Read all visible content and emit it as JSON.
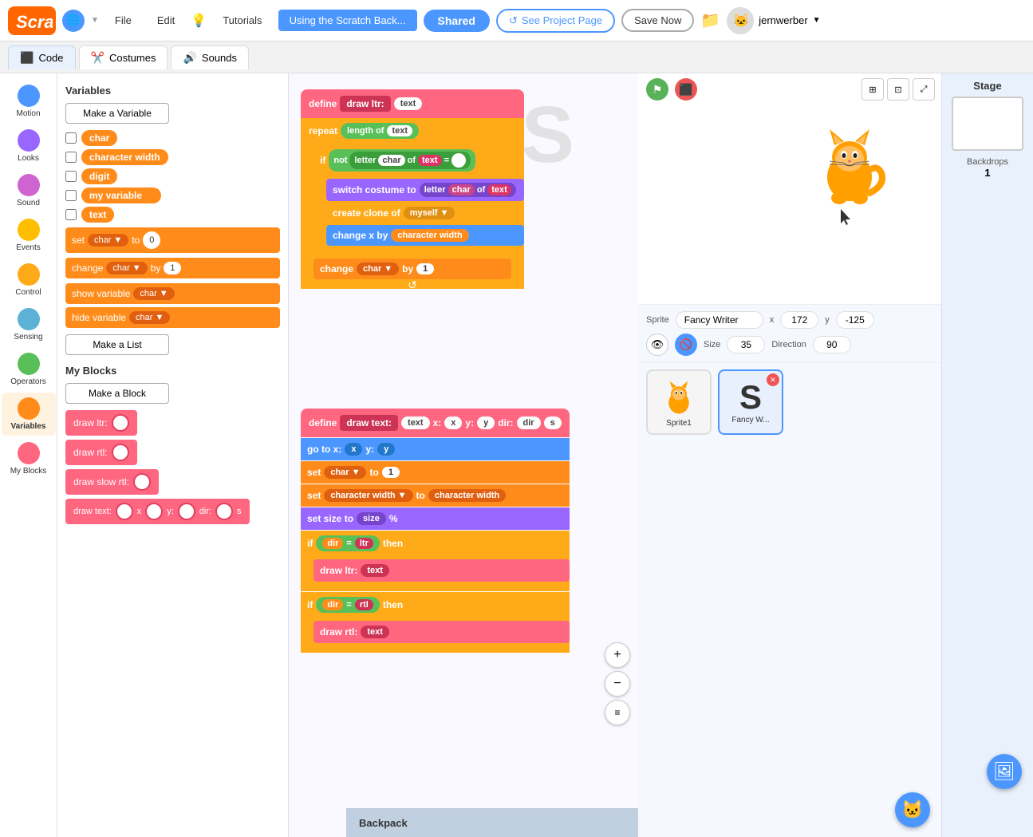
{
  "topbar": {
    "logo": "Scratch",
    "globe_label": "🌐",
    "file_label": "File",
    "edit_label": "Edit",
    "tutorials_label": "Tutorials",
    "project_name": "Using the Scratch Back...",
    "shared_label": "Shared",
    "see_project_label": "See Project Page",
    "save_label": "Save Now",
    "user_label": "jernwerber"
  },
  "tabs": {
    "code_label": "Code",
    "costumes_label": "Costumes",
    "sounds_label": "Sounds"
  },
  "categories": [
    {
      "id": "motion",
      "label": "Motion",
      "color": "#4c97ff"
    },
    {
      "id": "looks",
      "label": "Looks",
      "color": "#9966ff"
    },
    {
      "id": "sound",
      "label": "Sound",
      "color": "#cf63cf"
    },
    {
      "id": "events",
      "label": "Events",
      "color": "#ffbf00"
    },
    {
      "id": "control",
      "label": "Control",
      "color": "#ffab19"
    },
    {
      "id": "sensing",
      "label": "Sensing",
      "color": "#5cb1d6"
    },
    {
      "id": "operators",
      "label": "Operators",
      "color": "#59c059"
    },
    {
      "id": "variables",
      "label": "Variables",
      "color": "#ff8c1a"
    },
    {
      "id": "my-blocks",
      "label": "My Blocks",
      "color": "#ff6680"
    }
  ],
  "variables_section": {
    "title": "Variables",
    "make_variable_btn": "Make a Variable",
    "make_list_btn": "Make a List",
    "vars": [
      {
        "name": "char"
      },
      {
        "name": "character width"
      },
      {
        "name": "digit"
      },
      {
        "name": "my variable"
      },
      {
        "name": "text"
      }
    ],
    "set_block": "set",
    "char_label": "char",
    "to_label": "to",
    "val_0": "0",
    "change_label": "change",
    "by_label": "by",
    "val_1": "1",
    "show_variable": "show variable",
    "hide_variable": "hide variable"
  },
  "my_blocks_section": {
    "title": "My Blocks",
    "make_block_btn": "Make a Block",
    "blocks": [
      {
        "name": "draw ltr:",
        "has_input": true
      },
      {
        "name": "draw rtl:",
        "has_input": true
      },
      {
        "name": "draw slow rtl:",
        "has_input": true
      },
      {
        "name": "draw text:",
        "has_inputs": true
      }
    ]
  },
  "scripts": {
    "stack1": {
      "define_label": "define",
      "fn_name": "draw ltr:",
      "text_arg": "text",
      "repeat_label": "repeat",
      "length_of_label": "length of",
      "if_label": "if",
      "not_label": "not",
      "letter_label": "letter",
      "char_arg": "char",
      "of_label": "of",
      "text_arg2": "text",
      "switch_costume_label": "switch costume to",
      "char_arg2": "char",
      "of_label2": "of",
      "text_arg3": "text",
      "create_clone_label": "create clone of",
      "myself_label": "myself",
      "change_x_label": "change x by",
      "character_width_arg": "character width",
      "change_label": "change",
      "char_arg3": "char",
      "by_label": "by",
      "val_1": "1"
    },
    "stack2": {
      "define_label": "define",
      "fn_name": "draw text:",
      "args": "text x: x y: y dir: dir s",
      "go_to_x_label": "go to x:",
      "x_arg": "x",
      "y_arg": "y",
      "set_char_label": "set",
      "char_label": "char",
      "to_label": "to",
      "val_1": "1",
      "set_cw_label": "set",
      "cw_label": "character width",
      "to_label2": "to",
      "cw_arg": "character width",
      "set_size_label": "set size to",
      "size_arg": "size",
      "pct_label": "%",
      "if_label": "if",
      "dir_label": "dir",
      "eq_label": "=",
      "ltr_label": "ltr",
      "then_label": "then",
      "draw_ltr_label": "draw ltr:",
      "text_arg": "text",
      "if_label2": "if",
      "dir_label2": "dir",
      "eq_label2": "=",
      "rtl_label": "rtl",
      "then_label2": "then",
      "draw_rtl_label": "draw rtl:",
      "text_arg2": "text"
    }
  },
  "stage": {
    "sprite_label": "Sprite",
    "sprite_name": "Fancy Writer",
    "x_label": "x",
    "x_val": "172",
    "y_label": "y",
    "y_val": "-125",
    "size_label": "Size",
    "size_val": "35",
    "direction_label": "Direction",
    "direction_val": "90",
    "sprites": [
      {
        "name": "Sprite1",
        "selected": false
      },
      {
        "name": "Fancy W...",
        "selected": true
      }
    ],
    "stage_label": "Stage",
    "backdrops_label": "Backdrops",
    "backdrops_count": "1"
  },
  "backpack": {
    "label": "Backpack"
  }
}
